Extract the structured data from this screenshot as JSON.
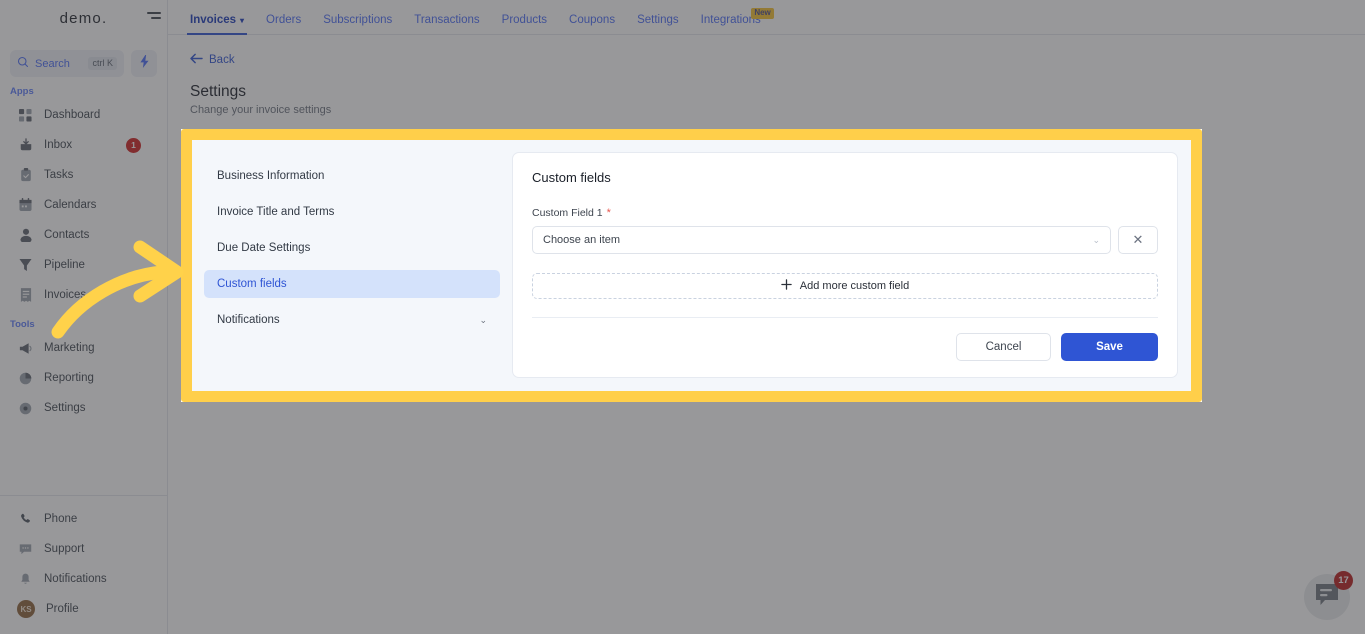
{
  "sidebar": {
    "brand": "demo.",
    "search": {
      "label": "Search",
      "shortcut": "ctrl K",
      "icon": "search-icon"
    },
    "quick_action_icon": "bolt-icon",
    "sections": [
      {
        "label": "Apps",
        "items": [
          {
            "label": "Dashboard",
            "icon": "grid-icon",
            "badge": ""
          },
          {
            "label": "Inbox",
            "icon": "inbox-icon",
            "badge": "1"
          },
          {
            "label": "Tasks",
            "icon": "clipboard-check-icon",
            "badge": ""
          },
          {
            "label": "Calendars",
            "icon": "calendar-icon",
            "badge": ""
          },
          {
            "label": "Contacts",
            "icon": "person-icon",
            "badge": ""
          },
          {
            "label": "Pipeline",
            "icon": "funnel-icon",
            "badge": ""
          },
          {
            "label": "Invoices",
            "icon": "receipt-icon",
            "badge": ""
          }
        ]
      },
      {
        "label": "Tools",
        "items": [
          {
            "label": "Marketing",
            "icon": "megaphone-icon",
            "badge": ""
          },
          {
            "label": "Reporting",
            "icon": "pie-chart-icon",
            "badge": ""
          },
          {
            "label": "Settings",
            "icon": "gear-icon",
            "badge": ""
          }
        ]
      }
    ],
    "bottom_items": [
      {
        "label": "Phone",
        "icon": "phone-icon"
      },
      {
        "label": "Support",
        "icon": "chat-bubble-icon"
      },
      {
        "label": "Notifications",
        "icon": "bell-icon"
      }
    ],
    "profile": {
      "label": "Profile",
      "initials": "KS"
    }
  },
  "topnav": {
    "tabs": [
      {
        "label": "Invoices",
        "active": true,
        "has_chevron": true,
        "badge": ""
      },
      {
        "label": "Orders",
        "active": false,
        "has_chevron": false,
        "badge": ""
      },
      {
        "label": "Subscriptions",
        "active": false,
        "has_chevron": false,
        "badge": ""
      },
      {
        "label": "Transactions",
        "active": false,
        "has_chevron": false,
        "badge": ""
      },
      {
        "label": "Products",
        "active": false,
        "has_chevron": false,
        "badge": ""
      },
      {
        "label": "Coupons",
        "active": false,
        "has_chevron": false,
        "badge": ""
      },
      {
        "label": "Settings",
        "active": false,
        "has_chevron": false,
        "badge": ""
      },
      {
        "label": "Integrations",
        "active": false,
        "has_chevron": false,
        "badge": "New"
      }
    ]
  },
  "page": {
    "back_label": "Back",
    "title": "Settings",
    "subtitle": "Change your invoice settings"
  },
  "settings_nav": {
    "items": [
      {
        "label": "Business Information",
        "selected": false,
        "chevron": ""
      },
      {
        "label": "Invoice Title and Terms",
        "selected": false,
        "chevron": ""
      },
      {
        "label": "Due Date Settings",
        "selected": false,
        "chevron": ""
      },
      {
        "label": "Custom fields",
        "selected": true,
        "chevron": ""
      },
      {
        "label": "Notifications",
        "selected": false,
        "chevron": "⌄"
      }
    ]
  },
  "custom_fields_card": {
    "title": "Custom fields",
    "field_label": "Custom Field 1",
    "required_marker": "*",
    "select_placeholder": "Choose an item",
    "clear_icon": "close-icon",
    "add_more_label": "Add more custom field",
    "add_more_icon": "plus-icon",
    "cancel_label": "Cancel",
    "save_label": "Save"
  },
  "chat_widget": {
    "icon": "chat-bubble-icon",
    "badge": "17"
  },
  "colors": {
    "accent_blue": "#2f55d4",
    "highlight_yellow": "#ffcf4a",
    "selected_nav_bg": "#d4e2fb",
    "badge_red": "#d02020",
    "required_red": "#e8584f",
    "new_badge_yellow": "#f5c12e"
  }
}
